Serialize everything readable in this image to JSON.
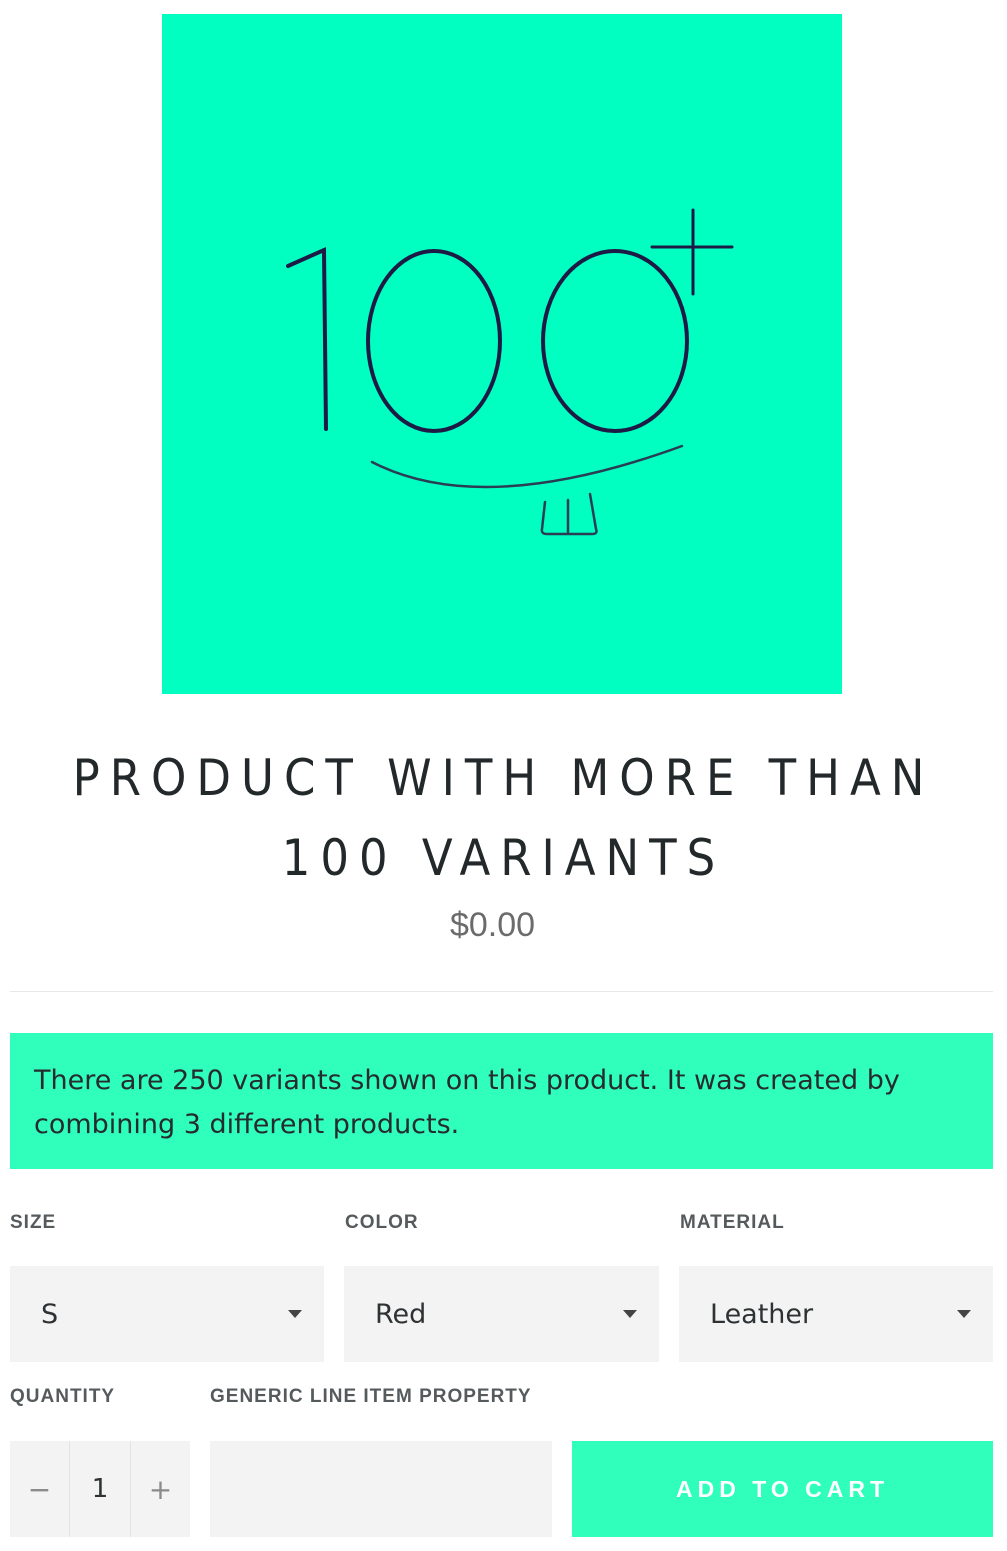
{
  "product": {
    "title": "PRODUCT WITH MORE THAN 100 VARIANTS",
    "price": "$0.00",
    "notice": "There are 250 variants shown on this product. It was created by combining 3 different products.",
    "image_bg": "#00ffc0",
    "accent": "#30ffbb"
  },
  "options": [
    {
      "label": "SIZE",
      "value": "S"
    },
    {
      "label": "COLOR",
      "value": "Red"
    },
    {
      "label": "MATERIAL",
      "value": "Leather"
    }
  ],
  "quantity": {
    "label": "QUANTITY",
    "minus": "−",
    "value": "1",
    "plus": "+"
  },
  "line_item": {
    "label": "GENERIC LINE ITEM PROPERTY",
    "value": ""
  },
  "cart": {
    "button_label": "ADD TO CART"
  }
}
